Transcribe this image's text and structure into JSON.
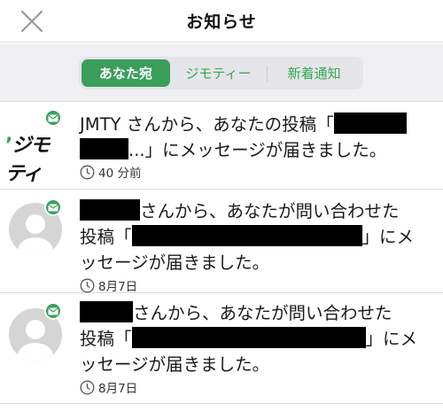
{
  "header": {
    "title": "お知らせ"
  },
  "tabs": [
    {
      "label": "あなた宛",
      "active": true
    },
    {
      "label": "ジモティー",
      "active": false
    },
    {
      "label": "新着通知",
      "active": false
    }
  ],
  "colors": {
    "accent": "#3a9f5b",
    "segment_bg": "#e5e5ea",
    "tabbar_bg": "#efeff4"
  },
  "notifications": [
    {
      "sender_logo": "ジモティ",
      "text_a": "JMTY さんから、あなたの投稿「",
      "text_b": "...」にメッセージが届きました。",
      "time": "40 分前"
    },
    {
      "text_a": "さんから、あなたが問い合わせた",
      "text_b": "投稿「",
      "text_c": "」にメ",
      "text_d": "ッセージが届きました。",
      "time": "8月7日"
    },
    {
      "text_a": "さんから、あなたが問い合わせた",
      "text_b": "投稿「",
      "text_c": "」にメ",
      "text_d": "ッセージが届きました。",
      "time": "8月7日"
    }
  ]
}
